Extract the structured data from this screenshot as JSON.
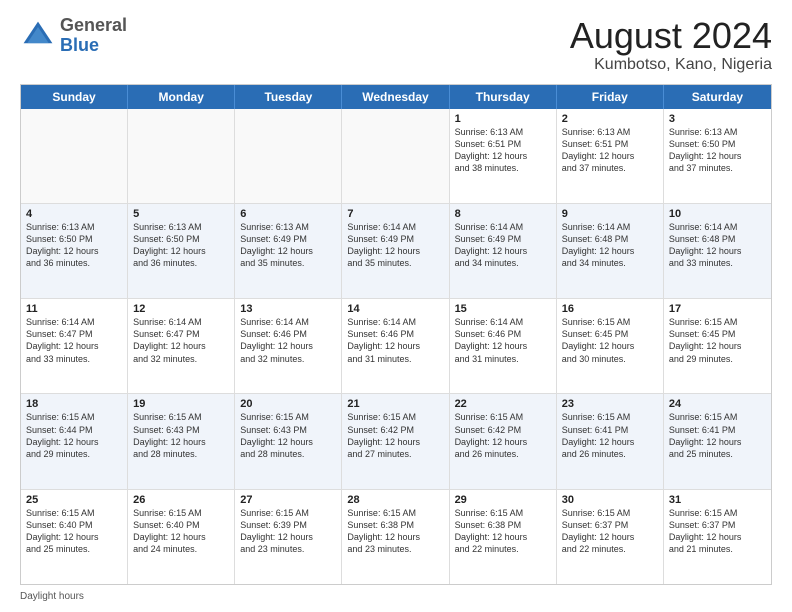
{
  "header": {
    "logo_general": "General",
    "logo_blue": "Blue",
    "month_year": "August 2024",
    "location": "Kumbotso, Kano, Nigeria"
  },
  "days_of_week": [
    "Sunday",
    "Monday",
    "Tuesday",
    "Wednesday",
    "Thursday",
    "Friday",
    "Saturday"
  ],
  "footer": "Daylight hours",
  "weeks": [
    [
      {
        "day": "",
        "text": ""
      },
      {
        "day": "",
        "text": ""
      },
      {
        "day": "",
        "text": ""
      },
      {
        "day": "",
        "text": ""
      },
      {
        "day": "1",
        "text": "Sunrise: 6:13 AM\nSunset: 6:51 PM\nDaylight: 12 hours\nand 38 minutes."
      },
      {
        "day": "2",
        "text": "Sunrise: 6:13 AM\nSunset: 6:51 PM\nDaylight: 12 hours\nand 37 minutes."
      },
      {
        "day": "3",
        "text": "Sunrise: 6:13 AM\nSunset: 6:50 PM\nDaylight: 12 hours\nand 37 minutes."
      }
    ],
    [
      {
        "day": "4",
        "text": "Sunrise: 6:13 AM\nSunset: 6:50 PM\nDaylight: 12 hours\nand 36 minutes."
      },
      {
        "day": "5",
        "text": "Sunrise: 6:13 AM\nSunset: 6:50 PM\nDaylight: 12 hours\nand 36 minutes."
      },
      {
        "day": "6",
        "text": "Sunrise: 6:13 AM\nSunset: 6:49 PM\nDaylight: 12 hours\nand 35 minutes."
      },
      {
        "day": "7",
        "text": "Sunrise: 6:14 AM\nSunset: 6:49 PM\nDaylight: 12 hours\nand 35 minutes."
      },
      {
        "day": "8",
        "text": "Sunrise: 6:14 AM\nSunset: 6:49 PM\nDaylight: 12 hours\nand 34 minutes."
      },
      {
        "day": "9",
        "text": "Sunrise: 6:14 AM\nSunset: 6:48 PM\nDaylight: 12 hours\nand 34 minutes."
      },
      {
        "day": "10",
        "text": "Sunrise: 6:14 AM\nSunset: 6:48 PM\nDaylight: 12 hours\nand 33 minutes."
      }
    ],
    [
      {
        "day": "11",
        "text": "Sunrise: 6:14 AM\nSunset: 6:47 PM\nDaylight: 12 hours\nand 33 minutes."
      },
      {
        "day": "12",
        "text": "Sunrise: 6:14 AM\nSunset: 6:47 PM\nDaylight: 12 hours\nand 32 minutes."
      },
      {
        "day": "13",
        "text": "Sunrise: 6:14 AM\nSunset: 6:46 PM\nDaylight: 12 hours\nand 32 minutes."
      },
      {
        "day": "14",
        "text": "Sunrise: 6:14 AM\nSunset: 6:46 PM\nDaylight: 12 hours\nand 31 minutes."
      },
      {
        "day": "15",
        "text": "Sunrise: 6:14 AM\nSunset: 6:46 PM\nDaylight: 12 hours\nand 31 minutes."
      },
      {
        "day": "16",
        "text": "Sunrise: 6:15 AM\nSunset: 6:45 PM\nDaylight: 12 hours\nand 30 minutes."
      },
      {
        "day": "17",
        "text": "Sunrise: 6:15 AM\nSunset: 6:45 PM\nDaylight: 12 hours\nand 29 minutes."
      }
    ],
    [
      {
        "day": "18",
        "text": "Sunrise: 6:15 AM\nSunset: 6:44 PM\nDaylight: 12 hours\nand 29 minutes."
      },
      {
        "day": "19",
        "text": "Sunrise: 6:15 AM\nSunset: 6:43 PM\nDaylight: 12 hours\nand 28 minutes."
      },
      {
        "day": "20",
        "text": "Sunrise: 6:15 AM\nSunset: 6:43 PM\nDaylight: 12 hours\nand 28 minutes."
      },
      {
        "day": "21",
        "text": "Sunrise: 6:15 AM\nSunset: 6:42 PM\nDaylight: 12 hours\nand 27 minutes."
      },
      {
        "day": "22",
        "text": "Sunrise: 6:15 AM\nSunset: 6:42 PM\nDaylight: 12 hours\nand 26 minutes."
      },
      {
        "day": "23",
        "text": "Sunrise: 6:15 AM\nSunset: 6:41 PM\nDaylight: 12 hours\nand 26 minutes."
      },
      {
        "day": "24",
        "text": "Sunrise: 6:15 AM\nSunset: 6:41 PM\nDaylight: 12 hours\nand 25 minutes."
      }
    ],
    [
      {
        "day": "25",
        "text": "Sunrise: 6:15 AM\nSunset: 6:40 PM\nDaylight: 12 hours\nand 25 minutes."
      },
      {
        "day": "26",
        "text": "Sunrise: 6:15 AM\nSunset: 6:40 PM\nDaylight: 12 hours\nand 24 minutes."
      },
      {
        "day": "27",
        "text": "Sunrise: 6:15 AM\nSunset: 6:39 PM\nDaylight: 12 hours\nand 23 minutes."
      },
      {
        "day": "28",
        "text": "Sunrise: 6:15 AM\nSunset: 6:38 PM\nDaylight: 12 hours\nand 23 minutes."
      },
      {
        "day": "29",
        "text": "Sunrise: 6:15 AM\nSunset: 6:38 PM\nDaylight: 12 hours\nand 22 minutes."
      },
      {
        "day": "30",
        "text": "Sunrise: 6:15 AM\nSunset: 6:37 PM\nDaylight: 12 hours\nand 22 minutes."
      },
      {
        "day": "31",
        "text": "Sunrise: 6:15 AM\nSunset: 6:37 PM\nDaylight: 12 hours\nand 21 minutes."
      }
    ]
  ]
}
